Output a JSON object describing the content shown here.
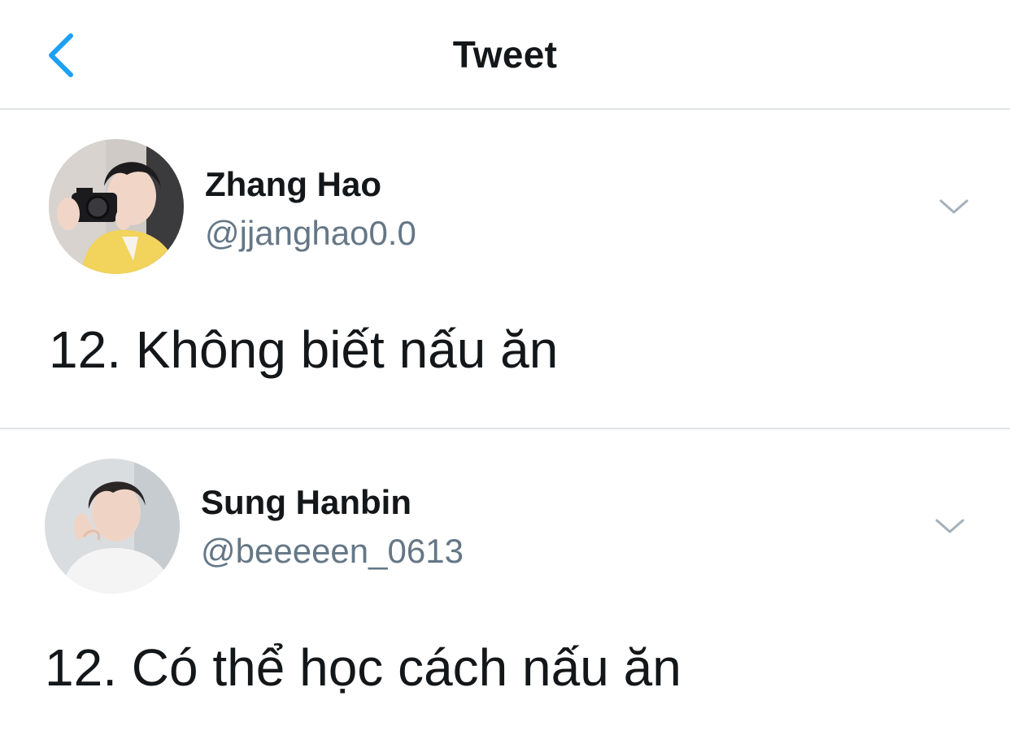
{
  "header": {
    "title": "Tweet",
    "back_icon": "chevron-left-icon",
    "accent_color": "#1da1f2"
  },
  "tweets": [
    {
      "display_name": "Zhang Hao",
      "handle": "@jjanghao0.0",
      "text": "12. Không biết nấu ăn",
      "menu_icon": "chevron-down-icon"
    },
    {
      "display_name": "Sung Hanbin",
      "handle": "@beeeeen_0613",
      "text": "12. Có thể học cách nấu ăn",
      "menu_icon": "chevron-down-icon"
    }
  ],
  "colors": {
    "text_primary": "#14171a",
    "text_secondary": "#657786",
    "divider": "#e1e4e7"
  }
}
